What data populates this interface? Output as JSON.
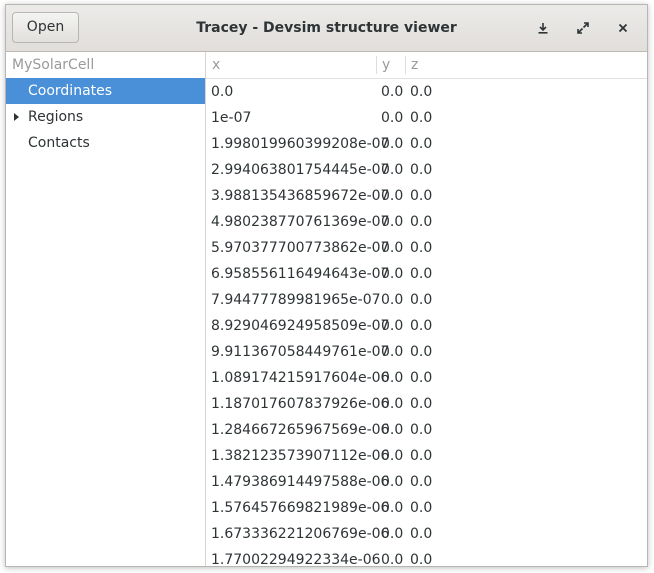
{
  "header": {
    "open_label": "Open",
    "title": "Tracey - Devsim structure viewer",
    "icons": [
      "download-icon",
      "maximize-icon",
      "close-icon"
    ]
  },
  "sidebar": {
    "root": "MySolarCell",
    "items": [
      {
        "label": "Coordinates",
        "selected": true,
        "expandable": false
      },
      {
        "label": "Regions",
        "selected": false,
        "expandable": true
      },
      {
        "label": "Contacts",
        "selected": false,
        "expandable": false
      }
    ]
  },
  "table": {
    "columns": [
      "x",
      "y",
      "z"
    ],
    "rows": [
      [
        "0.0",
        "0.0",
        "0.0"
      ],
      [
        "1e-07",
        "0.0",
        "0.0"
      ],
      [
        "1.998019960399208e-07",
        "0.0",
        "0.0"
      ],
      [
        "2.994063801754445e-07",
        "0.0",
        "0.0"
      ],
      [
        "3.988135436859672e-07",
        "0.0",
        "0.0"
      ],
      [
        "4.980238770761369e-07",
        "0.0",
        "0.0"
      ],
      [
        "5.970377700773862e-07",
        "0.0",
        "0.0"
      ],
      [
        "6.958556116494643e-07",
        "0.0",
        "0.0"
      ],
      [
        "7.94477789981965e-07",
        "0.0",
        "0.0"
      ],
      [
        "8.929046924958509e-07",
        "0.0",
        "0.0"
      ],
      [
        "9.911367058449761e-07",
        "0.0",
        "0.0"
      ],
      [
        "1.089174215917604e-06",
        "0.0",
        "0.0"
      ],
      [
        "1.187017607837926e-06",
        "0.0",
        "0.0"
      ],
      [
        "1.284667265967569e-06",
        "0.0",
        "0.0"
      ],
      [
        "1.382123573907112e-06",
        "0.0",
        "0.0"
      ],
      [
        "1.479386914497588e-06",
        "0.0",
        "0.0"
      ],
      [
        "1.576457669821989e-06",
        "0.0",
        "0.0"
      ],
      [
        "1.673336221206769e-06",
        "0.0",
        "0.0"
      ],
      [
        "1.77002294922334e-06",
        "0.0",
        "0.0"
      ]
    ]
  },
  "colors": {
    "selection": "#4a90d9",
    "header_text_muted": "#9a9a9a"
  }
}
